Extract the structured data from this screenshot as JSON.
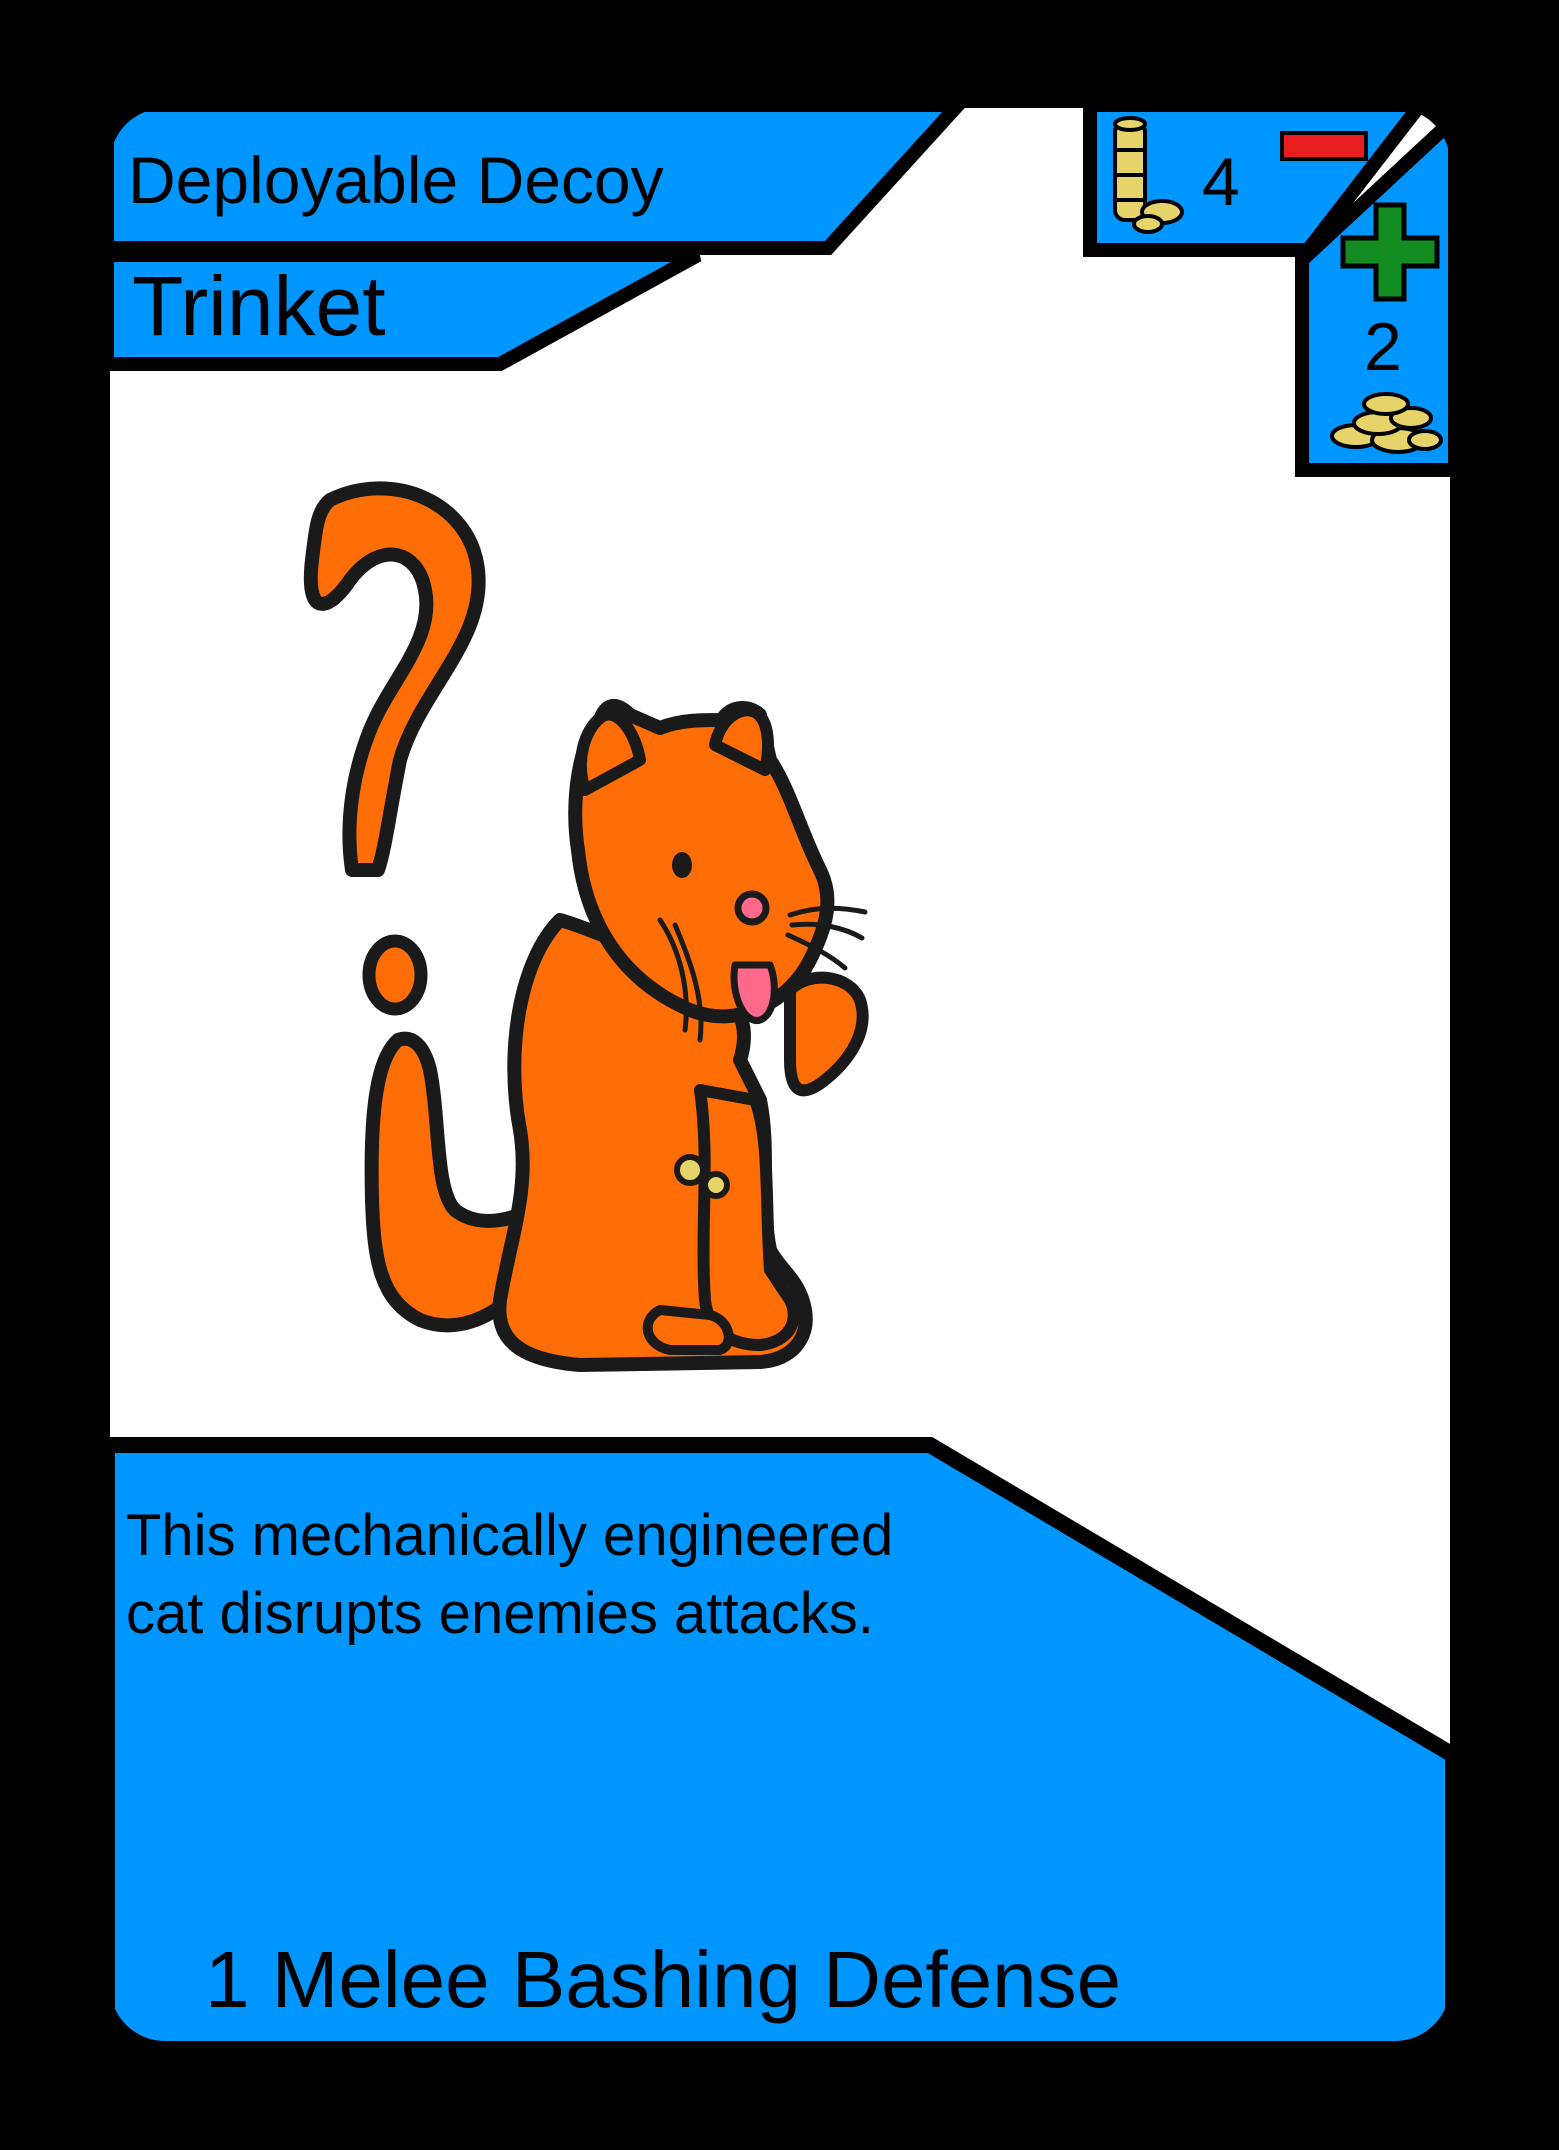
{
  "card": {
    "name": "Deployable Decoy",
    "type": "Trinket",
    "cost": "4",
    "value": "2",
    "description_lines": [
      "This mechanically engineered",
      "cat disrupts enemies attacks."
    ],
    "stats": "1 Melee Bashing Defense"
  },
  "icons": {
    "cost": "coin-stack-icon",
    "minus": "minus-icon",
    "plus": "plus-icon",
    "value": "coin-pile-icon",
    "illustration": "cat-with-question-mark-illustration"
  },
  "colors": {
    "background": "#000000",
    "card_white": "#ffffff",
    "panel_blue": "#0096ff",
    "minus_red": "#e81e1e",
    "plus_green": "#128c20",
    "coin_gold": "#e6d46a",
    "cat_orange": "#ff6e06",
    "tongue_pink": "#ff6a8c"
  }
}
